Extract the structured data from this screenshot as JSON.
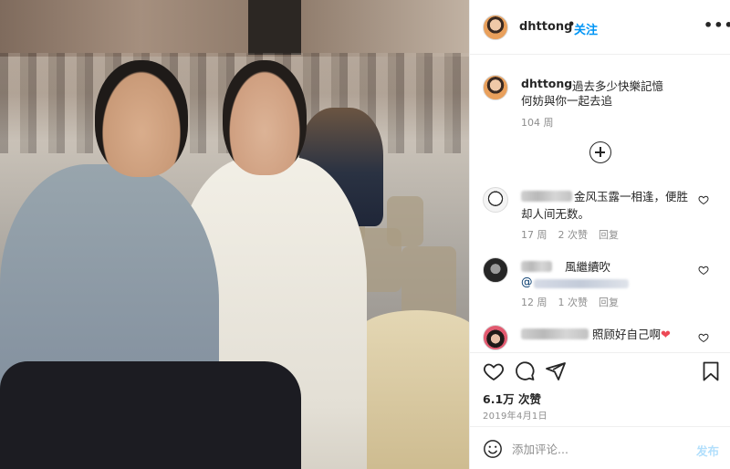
{
  "post": {
    "username": "dhttong",
    "separator": "•",
    "follow_label": "关注",
    "more_label": "•••"
  },
  "caption": {
    "username": "dhttong",
    "line1": "過去多少快樂記憶",
    "line2": "何妨與你一起去追",
    "time": "104 周"
  },
  "comments": [
    {
      "text_line1": "金风玉露一相逢，便胜",
      "text_line2": "却人间无数。",
      "time": "17 周",
      "likes": "2 次赞",
      "reply": "回复"
    },
    {
      "text_line1": "風繼續吹",
      "mention": "@",
      "time": "12 周",
      "likes": "1 次赞",
      "reply": "回复"
    },
    {
      "text_line1": "照顾好自己啊",
      "emoji": "❤"
    }
  ],
  "actions": {
    "likes_count": "6.1万 次赞",
    "date": "2019年4月1日"
  },
  "add_comment": {
    "placeholder": "添加评论...",
    "post_label": "发布"
  },
  "colors": {
    "link_blue": "#0095f6",
    "post_disabled": "#b2dffc",
    "secondary_text": "#8e8e8e",
    "heart_red": "#ed4956"
  },
  "icons": [
    "more-icon",
    "add-circle-icon",
    "heart-icon",
    "comment-icon",
    "share-icon",
    "bookmark-icon",
    "emoji-icon"
  ]
}
